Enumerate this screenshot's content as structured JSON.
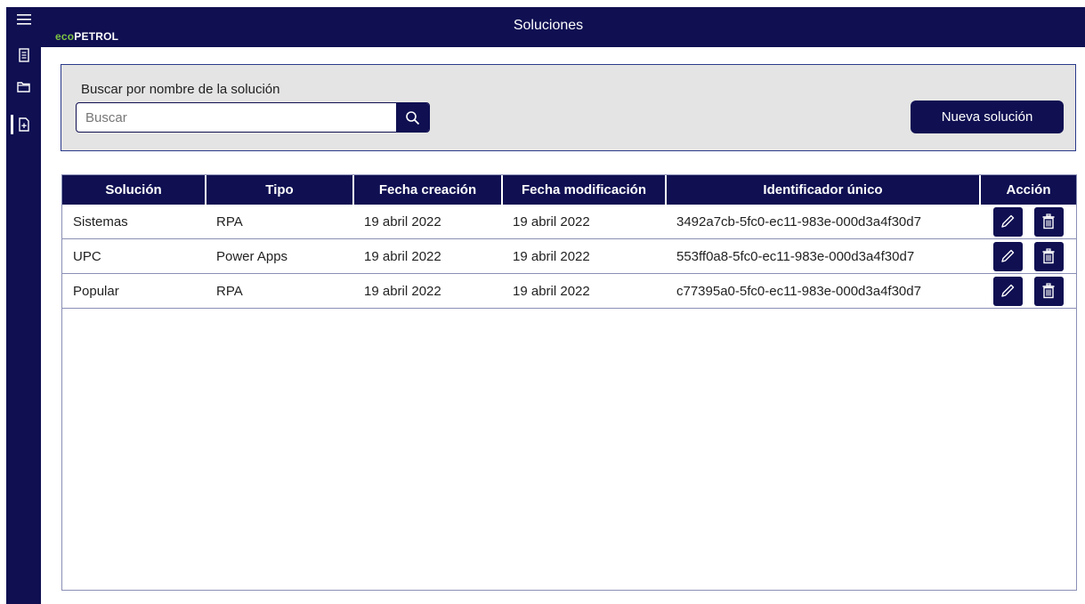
{
  "header": {
    "title": "Soluciones",
    "logo_eco": "eco",
    "logo_rest": "PETROL"
  },
  "rail": {
    "items": [
      {
        "icon": "hamburger-menu-icon"
      },
      {
        "icon": "document-list-icon"
      },
      {
        "icon": "folder-icon"
      },
      {
        "icon": "add-document-icon",
        "active": true
      }
    ]
  },
  "search": {
    "label": "Buscar por nombre de la solución",
    "placeholder": "Buscar",
    "value": ""
  },
  "new_button_label": "Nueva solución",
  "table": {
    "columns": [
      "Solución",
      "Tipo",
      "Fecha creación",
      "Fecha modificación",
      "Identificador único",
      "Acción"
    ],
    "rows": [
      {
        "solucion": "Sistemas",
        "tipo": "RPA",
        "creacion": "19 abril 2022",
        "modificacion": "19 abril 2022",
        "id": "3492a7cb-5fc0-ec11-983e-000d3a4f30d7"
      },
      {
        "solucion": "UPC",
        "tipo": "Power Apps",
        "creacion": "19 abril 2022",
        "modificacion": "19 abril 2022",
        "id": "553ff0a8-5fc0-ec11-983e-000d3a4f30d7"
      },
      {
        "solucion": "Popular",
        "tipo": "RPA",
        "creacion": "19 abril 2022",
        "modificacion": "19 abril 2022",
        "id": "c77395a0-5fc0-ec11-983e-000d3a4f30d7"
      }
    ]
  },
  "colors": {
    "navy": "#0f0f52",
    "panel_bg": "#e4e4e4",
    "logo_green": "#7cc242"
  }
}
